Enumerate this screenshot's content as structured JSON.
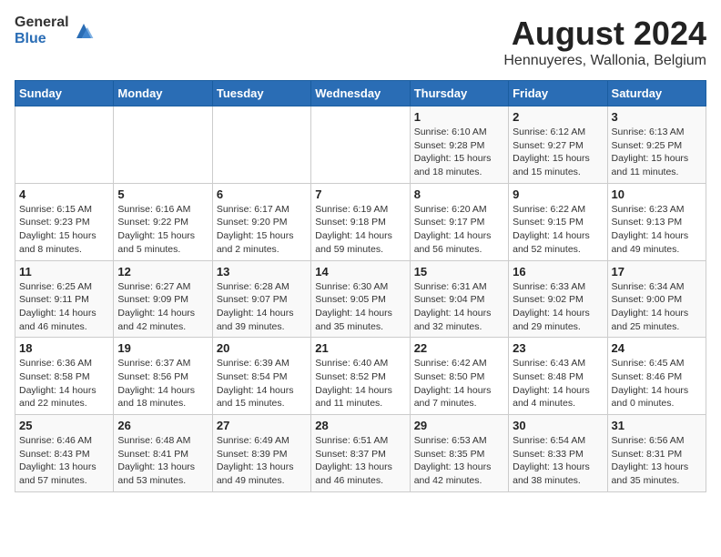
{
  "header": {
    "logo_general": "General",
    "logo_blue": "Blue",
    "title": "August 2024",
    "subtitle": "Hennuyeres, Wallonia, Belgium"
  },
  "weekdays": [
    "Sunday",
    "Monday",
    "Tuesday",
    "Wednesday",
    "Thursday",
    "Friday",
    "Saturday"
  ],
  "weeks": [
    [
      {
        "day": "",
        "info": ""
      },
      {
        "day": "",
        "info": ""
      },
      {
        "day": "",
        "info": ""
      },
      {
        "day": "",
        "info": ""
      },
      {
        "day": "1",
        "info": "Sunrise: 6:10 AM\nSunset: 9:28 PM\nDaylight: 15 hours\nand 18 minutes."
      },
      {
        "day": "2",
        "info": "Sunrise: 6:12 AM\nSunset: 9:27 PM\nDaylight: 15 hours\nand 15 minutes."
      },
      {
        "day": "3",
        "info": "Sunrise: 6:13 AM\nSunset: 9:25 PM\nDaylight: 15 hours\nand 11 minutes."
      }
    ],
    [
      {
        "day": "4",
        "info": "Sunrise: 6:15 AM\nSunset: 9:23 PM\nDaylight: 15 hours\nand 8 minutes."
      },
      {
        "day": "5",
        "info": "Sunrise: 6:16 AM\nSunset: 9:22 PM\nDaylight: 15 hours\nand 5 minutes."
      },
      {
        "day": "6",
        "info": "Sunrise: 6:17 AM\nSunset: 9:20 PM\nDaylight: 15 hours\nand 2 minutes."
      },
      {
        "day": "7",
        "info": "Sunrise: 6:19 AM\nSunset: 9:18 PM\nDaylight: 14 hours\nand 59 minutes."
      },
      {
        "day": "8",
        "info": "Sunrise: 6:20 AM\nSunset: 9:17 PM\nDaylight: 14 hours\nand 56 minutes."
      },
      {
        "day": "9",
        "info": "Sunrise: 6:22 AM\nSunset: 9:15 PM\nDaylight: 14 hours\nand 52 minutes."
      },
      {
        "day": "10",
        "info": "Sunrise: 6:23 AM\nSunset: 9:13 PM\nDaylight: 14 hours\nand 49 minutes."
      }
    ],
    [
      {
        "day": "11",
        "info": "Sunrise: 6:25 AM\nSunset: 9:11 PM\nDaylight: 14 hours\nand 46 minutes."
      },
      {
        "day": "12",
        "info": "Sunrise: 6:27 AM\nSunset: 9:09 PM\nDaylight: 14 hours\nand 42 minutes."
      },
      {
        "day": "13",
        "info": "Sunrise: 6:28 AM\nSunset: 9:07 PM\nDaylight: 14 hours\nand 39 minutes."
      },
      {
        "day": "14",
        "info": "Sunrise: 6:30 AM\nSunset: 9:05 PM\nDaylight: 14 hours\nand 35 minutes."
      },
      {
        "day": "15",
        "info": "Sunrise: 6:31 AM\nSunset: 9:04 PM\nDaylight: 14 hours\nand 32 minutes."
      },
      {
        "day": "16",
        "info": "Sunrise: 6:33 AM\nSunset: 9:02 PM\nDaylight: 14 hours\nand 29 minutes."
      },
      {
        "day": "17",
        "info": "Sunrise: 6:34 AM\nSunset: 9:00 PM\nDaylight: 14 hours\nand 25 minutes."
      }
    ],
    [
      {
        "day": "18",
        "info": "Sunrise: 6:36 AM\nSunset: 8:58 PM\nDaylight: 14 hours\nand 22 minutes."
      },
      {
        "day": "19",
        "info": "Sunrise: 6:37 AM\nSunset: 8:56 PM\nDaylight: 14 hours\nand 18 minutes."
      },
      {
        "day": "20",
        "info": "Sunrise: 6:39 AM\nSunset: 8:54 PM\nDaylight: 14 hours\nand 15 minutes."
      },
      {
        "day": "21",
        "info": "Sunrise: 6:40 AM\nSunset: 8:52 PM\nDaylight: 14 hours\nand 11 minutes."
      },
      {
        "day": "22",
        "info": "Sunrise: 6:42 AM\nSunset: 8:50 PM\nDaylight: 14 hours\nand 7 minutes."
      },
      {
        "day": "23",
        "info": "Sunrise: 6:43 AM\nSunset: 8:48 PM\nDaylight: 14 hours\nand 4 minutes."
      },
      {
        "day": "24",
        "info": "Sunrise: 6:45 AM\nSunset: 8:46 PM\nDaylight: 14 hours\nand 0 minutes."
      }
    ],
    [
      {
        "day": "25",
        "info": "Sunrise: 6:46 AM\nSunset: 8:43 PM\nDaylight: 13 hours\nand 57 minutes."
      },
      {
        "day": "26",
        "info": "Sunrise: 6:48 AM\nSunset: 8:41 PM\nDaylight: 13 hours\nand 53 minutes."
      },
      {
        "day": "27",
        "info": "Sunrise: 6:49 AM\nSunset: 8:39 PM\nDaylight: 13 hours\nand 49 minutes."
      },
      {
        "day": "28",
        "info": "Sunrise: 6:51 AM\nSunset: 8:37 PM\nDaylight: 13 hours\nand 46 minutes."
      },
      {
        "day": "29",
        "info": "Sunrise: 6:53 AM\nSunset: 8:35 PM\nDaylight: 13 hours\nand 42 minutes."
      },
      {
        "day": "30",
        "info": "Sunrise: 6:54 AM\nSunset: 8:33 PM\nDaylight: 13 hours\nand 38 minutes."
      },
      {
        "day": "31",
        "info": "Sunrise: 6:56 AM\nSunset: 8:31 PM\nDaylight: 13 hours\nand 35 minutes."
      }
    ]
  ]
}
